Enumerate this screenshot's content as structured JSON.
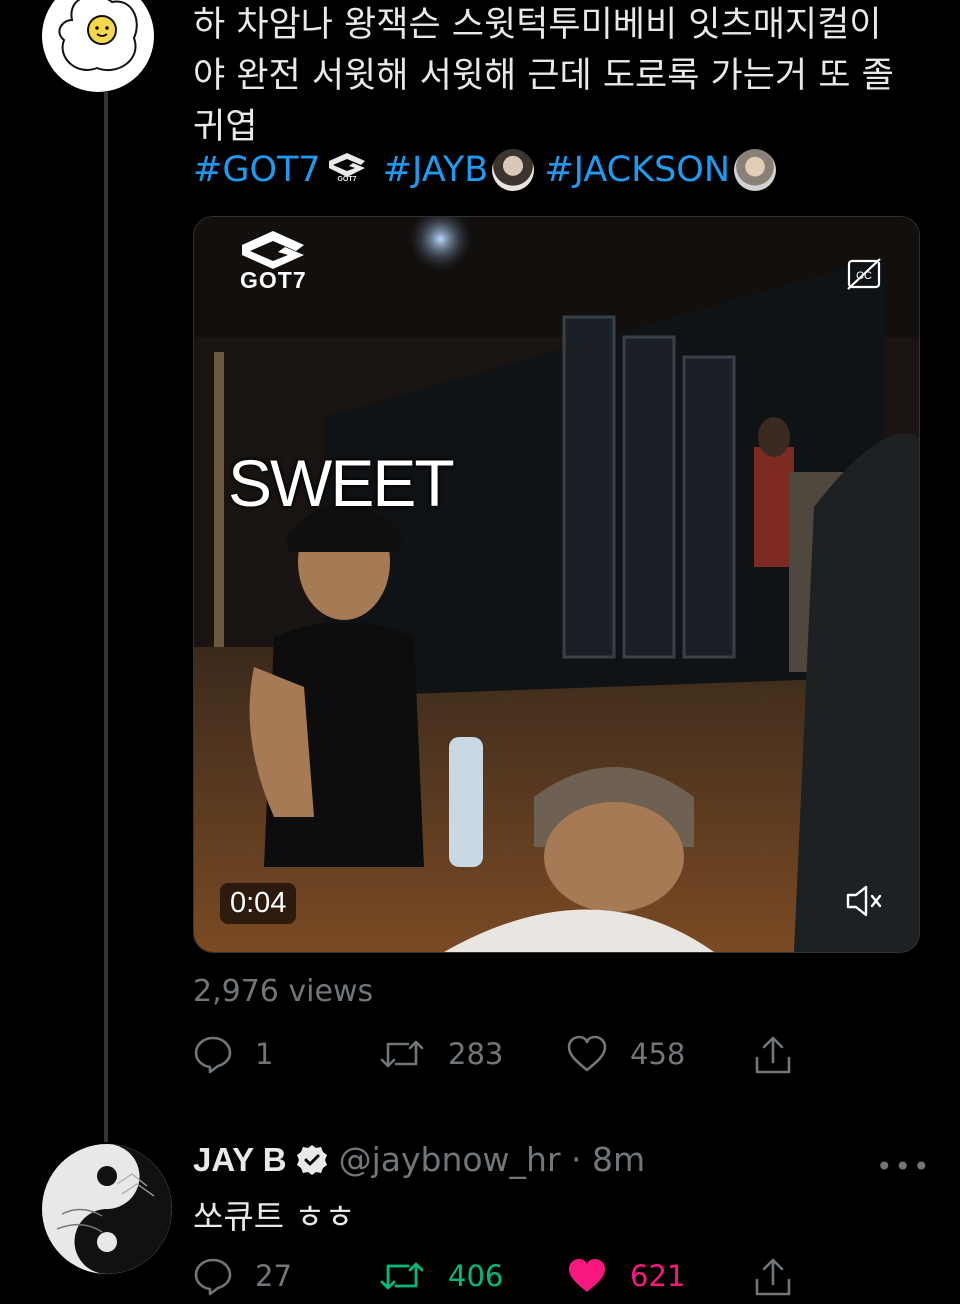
{
  "tweet": {
    "lines": [
      "하 차암나 왕잭슨 스윗턱투미베비 잇츠매지컬이",
      "야 완전 서윗해 서윗해 근데 도로록 가는거 또 졸",
      "귀엽"
    ],
    "hashtags": [
      "#GOT7",
      "#JAYB",
      "#JACKSON"
    ],
    "video": {
      "logo_text": "GOT7",
      "caption": "SWEET",
      "timestamp": "0:04"
    },
    "views": "2,976 views",
    "stats": {
      "replies": "1",
      "retweets": "283",
      "likes": "458"
    }
  },
  "reply": {
    "name": "JAY B",
    "handle": "@jaybnow_hr · 8m",
    "more": "•••",
    "text": "쏘큐트 ㅎㅎ",
    "stats": {
      "replies": "27",
      "retweets": "406",
      "likes": "621"
    }
  },
  "colors": {
    "background": "#000000",
    "text": "#e7e9ea",
    "muted": "#71767b",
    "hashtag": "#1d9bf0",
    "retweet_active": "#00ba7c",
    "like_active": "#f91880"
  }
}
